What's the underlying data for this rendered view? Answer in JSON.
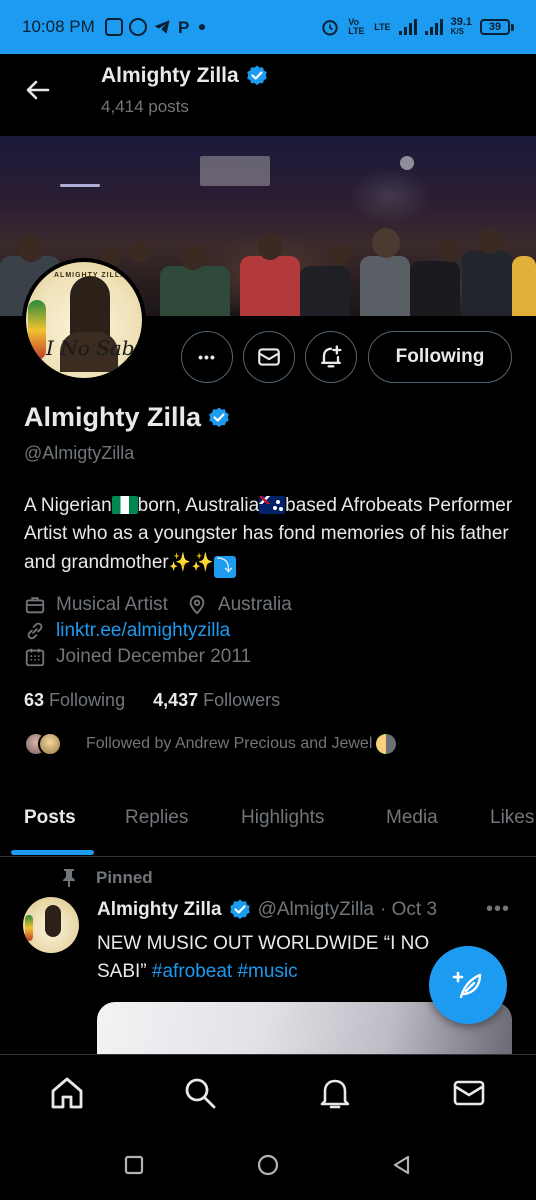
{
  "status_bar": {
    "time": "10:08 PM",
    "net_type": "Vo LTE",
    "net_type2": "LTE",
    "speed": "39.1",
    "speed_unit": "K/S",
    "battery": "39"
  },
  "header": {
    "title": "Almighty Zilla",
    "posts_count": "4,414 posts"
  },
  "profile": {
    "avatar_brand": "ALMIGHTY ZILLA",
    "avatar_signature": "I No Sabi",
    "name": "Almighty Zilla",
    "handle": "@AlmigtyZilla",
    "bio_part1": "A Nigerian",
    "bio_part2": "born, Australia",
    "bio_part3": "based Afrobeats Performer Artist who as a youngster has fond memories of his father and grandmother",
    "bio_sparkles": "✨✨",
    "bio_arrow": "⤵",
    "category": "Musical Artist",
    "location": "Australia",
    "link": "linktr.ee/almightyzilla",
    "joined": "Joined December 2011",
    "following_count": "63",
    "following_label": "Following",
    "followers_count": "4,437",
    "followers_label": "Followers",
    "followed_by": "Followed by Andrew Precious and Jewel"
  },
  "actions": {
    "more": "•••",
    "follow_label": "Following"
  },
  "tabs": [
    "Posts",
    "Replies",
    "Highlights",
    "Media",
    "Likes"
  ],
  "active_tab": "Posts",
  "pinned_post": {
    "pinned_label": "Pinned",
    "author": "Almighty Zilla",
    "handle": "@AlmigtyZilla",
    "date": "· Oct 3",
    "more": "•••",
    "text": "NEW MUSIC OUT WORLDWIDE “I NO SABI” ",
    "hashtag1": "#afrobeat",
    "hashtag2": "#music"
  },
  "bottom_nav": [
    "home-icon",
    "search-icon",
    "notifications-icon",
    "messages-icon"
  ],
  "colors": {
    "accent": "#1d9bf0",
    "background": "#000000",
    "text_primary": "#e7e9ea",
    "text_secondary": "#71767b"
  }
}
